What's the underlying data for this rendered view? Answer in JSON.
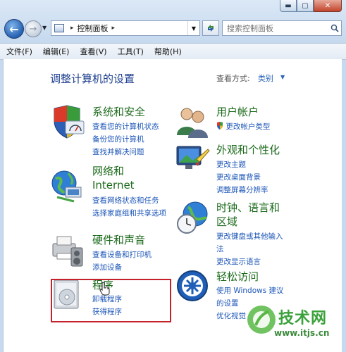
{
  "window": {
    "caption_buttons": [
      {
        "name": "minimize",
        "glyph": "▬"
      },
      {
        "name": "maximize",
        "glyph": "▢"
      },
      {
        "name": "close",
        "glyph": "✕"
      }
    ]
  },
  "navigation": {
    "address": {
      "separator": "▸",
      "location": "控制面板"
    },
    "search": {
      "placeholder": "搜索控制面板"
    }
  },
  "menu": {
    "items": [
      "文件(F)",
      "编辑(E)",
      "查看(V)",
      "工具(T)",
      "帮助(H)"
    ]
  },
  "content": {
    "title": "调整计算机的设置",
    "view_by_label": "查看方式:",
    "view_by_value": "类别",
    "left_categories": [
      {
        "title": "系统和安全",
        "links": [
          "查看您的计算机状态",
          "备份您的计算机",
          "查找并解决问题"
        ]
      },
      {
        "title_line1": "网络和",
        "title_line2": "Internet",
        "links": [
          "查看网络状态和任务",
          "选择家庭组和共享选项"
        ]
      },
      {
        "title": "硬件和声音",
        "links": [
          "查看设备和打印机",
          "添加设备"
        ]
      },
      {
        "title": "程序",
        "links": [
          "卸载程序",
          "获得程序"
        ]
      }
    ],
    "right_categories": [
      {
        "title": "用户帐户",
        "links": [
          "更改帐户类型"
        ]
      },
      {
        "title": "外观和个性化",
        "links": [
          "更改主题",
          "更改桌面背景",
          "调整屏幕分辨率"
        ]
      },
      {
        "title_line1": "时钟、语言和",
        "title_line2": "区域",
        "links": [
          "更改键盘或其他输入",
          "法",
          "更改显示语言"
        ]
      },
      {
        "title": "轻松访问",
        "links": [
          "使用 Windows 建议",
          "的设置",
          "优化视觉"
        ]
      }
    ]
  },
  "watermark": {
    "logo_text": "技术网",
    "url": "www.itjs.cn"
  },
  "colors": {
    "title_blue": "#1e3f8f",
    "category_green": "#1b6a1b",
    "link_blue": "#1d56b8",
    "highlight_red": "#c6202a"
  }
}
